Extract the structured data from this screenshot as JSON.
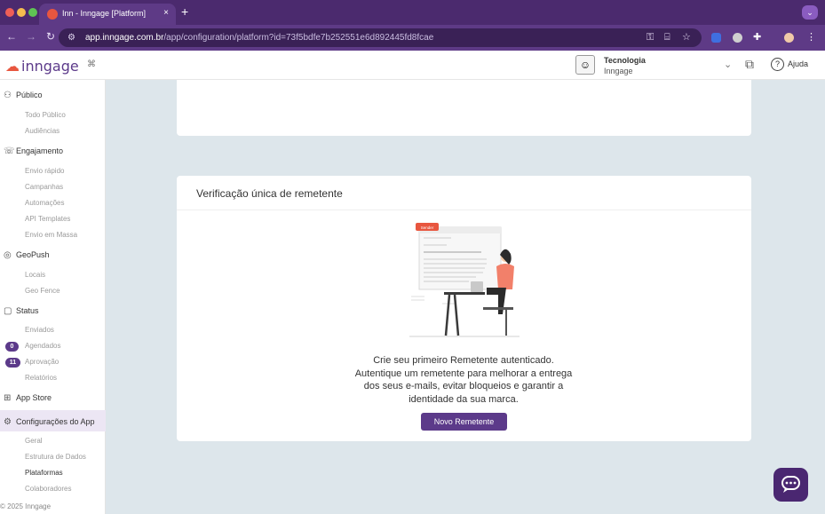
{
  "browser": {
    "tab_title": "Inn - Inngage [Platform]",
    "tab_close": "×",
    "new_tab": "+",
    "url_host": "app.inngage.com.br",
    "url_path": "/app/configuration/platform?id=73f5bdfe7b252551e6d892445fd8fcae"
  },
  "header": {
    "logo_text": "inngage",
    "user_name": "Tecnologia",
    "user_org": "Inngage",
    "help_label": "Ajuda"
  },
  "sidebar": {
    "publico": "Público",
    "todo_publico": "Todo Público",
    "audiencias": "Audiências",
    "engajamento": "Engajamento",
    "envio_rapido": "Envio rápido",
    "campanhas": "Campanhas",
    "automacoes": "Automações",
    "api_templates": "API Templates",
    "envio_massa": "Envio em Massa",
    "geopush": "GeoPush",
    "locais": "Locais",
    "geo_fence": "Geo Fence",
    "status": "Status",
    "enviados": "Enviados",
    "agendados": "Agendados",
    "agendados_count": "0",
    "aprovacao": "Aprovação",
    "aprovacao_count": "11",
    "relatorios": "Relatórios",
    "app_store": "App Store",
    "config_app": "Configurações do App",
    "geral": "Geral",
    "estrutura": "Estrutura de Dados",
    "plataformas": "Plataformas",
    "colaboradores": "Colaboradores",
    "copyright": "© 2025 Inngage"
  },
  "main": {
    "card_title": "Verificação única de remetente",
    "illustration_tag": "Sender",
    "message_lines": [
      "Crie seu primeiro Remetente autenticado.",
      "Autentique um remetente para melhorar a entrega",
      "dos seus e-mails, evitar bloqueios e garantir a",
      "identidade da sua marca."
    ],
    "button_label": "Novo Remetente"
  },
  "colors": {
    "brand_purple": "#5c3a8a",
    "brand_orange": "#e8563f",
    "browser_frame": "#5e3a86",
    "content_bg": "#dde6eb"
  }
}
